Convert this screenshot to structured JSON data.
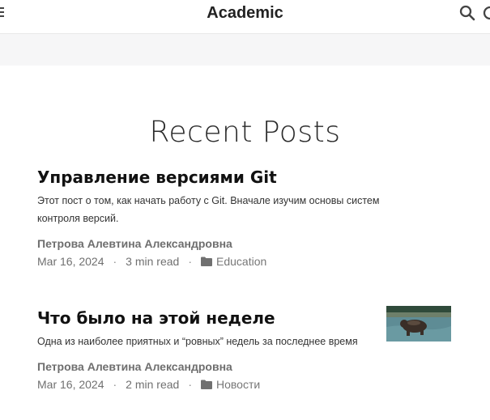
{
  "navbar": {
    "brand": "Academic"
  },
  "section": {
    "title": "Recent Posts"
  },
  "posts": [
    {
      "title": "Управление версиями Git",
      "summary": "Этот пост о том, как начать работу с Git. Вначале изучим основы систем контроля версий.",
      "author": "Петрова Алевтина Александровна",
      "date": "Mar 16, 2024",
      "read_time": "3 min read",
      "category": "Education",
      "has_thumbnail": false
    },
    {
      "title": "Что было на этой неделе",
      "summary": "Одна из наиболее приятных и “ровных” недель за последнее время",
      "author": "Петрова Алевтина Александровна",
      "date": "Mar 16, 2024",
      "read_time": "2 min read",
      "category": "Новости",
      "has_thumbnail": true
    }
  ],
  "meta_separator": "·",
  "colors": {
    "accent": "#222222",
    "muted": "#707070",
    "strip": "#f6f6f7"
  },
  "icons": [
    "menu-icon",
    "search-icon",
    "theme-icon",
    "folder-icon"
  ]
}
